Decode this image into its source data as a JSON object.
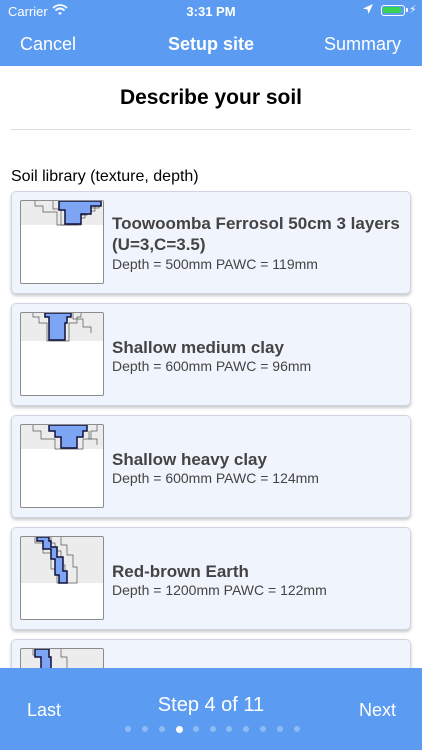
{
  "status_bar": {
    "carrier": "Carrier",
    "time": "3:31 PM"
  },
  "nav": {
    "cancel_label": "Cancel",
    "title": "Setup site",
    "summary_label": "Summary"
  },
  "page": {
    "heading": "Describe your soil",
    "section_label": "Soil library (texture, depth)"
  },
  "soil_library": [
    {
      "name": "Toowoomba Ferrosol 50cm 3 layers (U=3,C=3.5)",
      "stats": "Depth = 500mm PAWC = 119mm"
    },
    {
      "name": "Shallow medium clay",
      "stats": "Depth = 600mm PAWC = 96mm"
    },
    {
      "name": "Shallow heavy clay",
      "stats": "Depth = 600mm PAWC = 124mm"
    },
    {
      "name": "Red-brown Earth",
      "stats": "Depth = 1200mm PAWC = 122mm"
    },
    {
      "name": "",
      "stats": ""
    }
  ],
  "footer": {
    "last_label": "Last",
    "step_text": "Step 4 of 11",
    "next_label": "Next",
    "current_step": 4,
    "total_steps": 11
  },
  "colors": {
    "accent": "#5b9cf2",
    "card_background": "#f0f4fc",
    "profile_fill": "#7ea5f3",
    "profile_stroke": "#10113a"
  }
}
